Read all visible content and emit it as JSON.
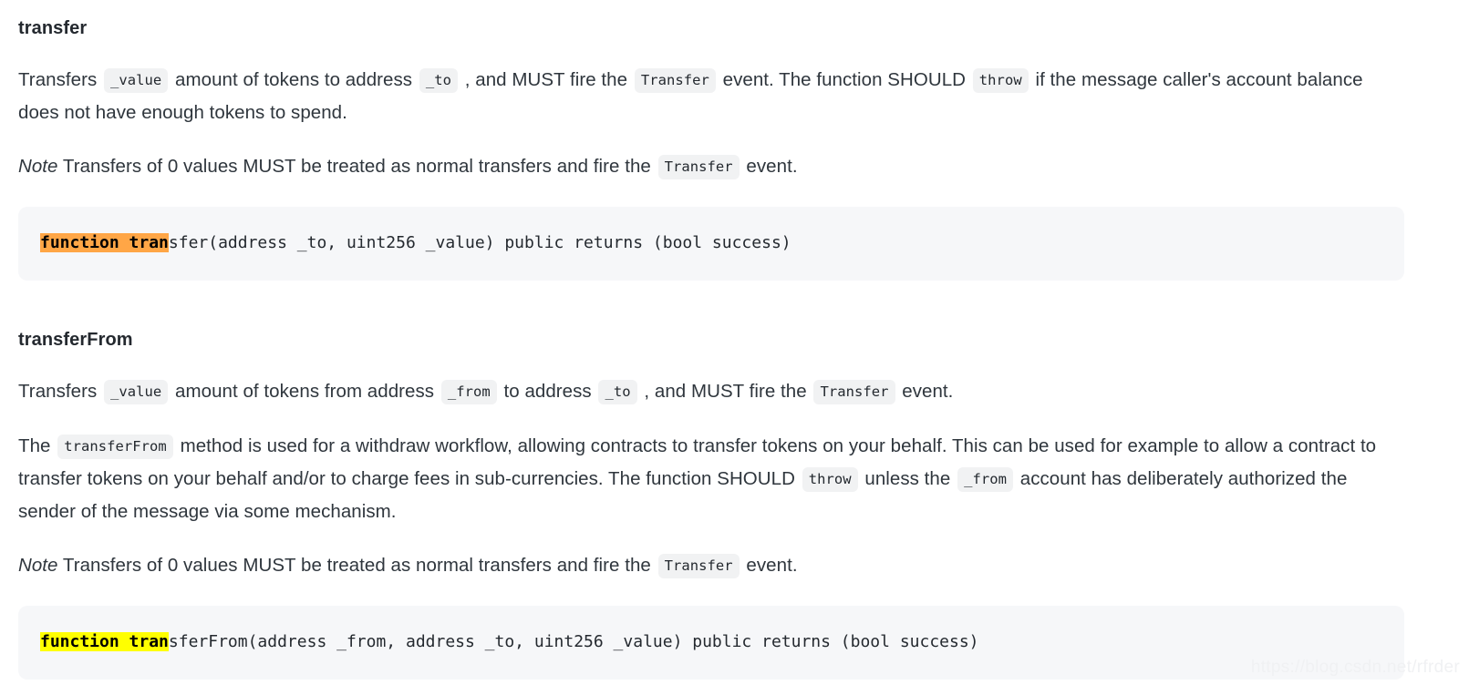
{
  "document": {
    "sections": [
      {
        "id": "transfer",
        "heading": "transfer",
        "paragraphs": [
          {
            "id": "transfer-desc",
            "parts": [
              {
                "type": "text",
                "text": "Transfers "
              },
              {
                "type": "code",
                "text": "_value"
              },
              {
                "type": "text",
                "text": " amount of tokens to address "
              },
              {
                "type": "code",
                "text": "_to"
              },
              {
                "type": "text",
                "text": " , and MUST fire the "
              },
              {
                "type": "code",
                "text": "Transfer"
              },
              {
                "type": "text",
                "text": " event. The function SHOULD "
              },
              {
                "type": "code",
                "text": "throw"
              },
              {
                "type": "text",
                "text": " if the message caller's account balance does not have enough tokens to spend."
              }
            ]
          },
          {
            "id": "transfer-note",
            "parts": [
              {
                "type": "italic",
                "text": "Note"
              },
              {
                "type": "text",
                "text": " Transfers of 0 values MUST be treated as normal transfers and fire the "
              },
              {
                "type": "code",
                "text": "Transfer"
              },
              {
                "type": "text",
                "text": " event."
              }
            ]
          }
        ],
        "code_block": {
          "highlight_text": "function tran",
          "highlight_color": "#ffa646",
          "rest_text": "sfer(address _to, uint256 _value) public returns (bool success)",
          "full_text": "function transfer(address _to, uint256 _value) public returns (bool success)"
        }
      },
      {
        "id": "transferFrom",
        "heading": "transferFrom",
        "paragraphs": [
          {
            "id": "transferfrom-desc",
            "parts": [
              {
                "type": "text",
                "text": "Transfers "
              },
              {
                "type": "code",
                "text": "_value"
              },
              {
                "type": "text",
                "text": " amount of tokens from address "
              },
              {
                "type": "code",
                "text": "_from"
              },
              {
                "type": "text",
                "text": " to address "
              },
              {
                "type": "code",
                "text": "_to"
              },
              {
                "type": "text",
                "text": " , and MUST fire the "
              },
              {
                "type": "code",
                "text": "Transfer"
              },
              {
                "type": "text",
                "text": " event."
              }
            ]
          },
          {
            "id": "transferfrom-detail",
            "parts": [
              {
                "type": "text",
                "text": "The "
              },
              {
                "type": "code",
                "text": "transferFrom"
              },
              {
                "type": "text",
                "text": " method is used for a withdraw workflow, allowing contracts to transfer tokens on your behalf. This can be used for example to allow a contract to transfer tokens on your behalf and/or to charge fees in sub-currencies. The function SHOULD "
              },
              {
                "type": "code",
                "text": "throw"
              },
              {
                "type": "text",
                "text": " unless the "
              },
              {
                "type": "code",
                "text": "_from"
              },
              {
                "type": "text",
                "text": " account has deliberately authorized the sender of the message via some mechanism."
              }
            ]
          },
          {
            "id": "transferfrom-note",
            "parts": [
              {
                "type": "italic",
                "text": "Note"
              },
              {
                "type": "text",
                "text": " Transfers of 0 values MUST be treated as normal transfers and fire the "
              },
              {
                "type": "code",
                "text": "Transfer"
              },
              {
                "type": "text",
                "text": " event."
              }
            ]
          }
        ],
        "code_block": {
          "highlight_text": "function tran",
          "highlight_color": "#ffff00",
          "rest_text": "sferFrom(address _from, address _to, uint256 _value) public returns (bool success)",
          "full_text": "function transferFrom(address _from, address _to, uint256 _value) public returns (bool success)"
        }
      }
    ]
  },
  "watermark": {
    "text": "https://blog.csdn.net/rfrder"
  },
  "colors": {
    "body_text": "#2f363d",
    "heading_text": "#24292f",
    "inline_code_bg": "#f1f2f3",
    "code_block_bg": "#f6f7f9",
    "highlight_orange": "#ffa646",
    "highlight_yellow": "#ffff00",
    "watermark": "#f0f1f3",
    "page_bg": "#ffffff"
  }
}
